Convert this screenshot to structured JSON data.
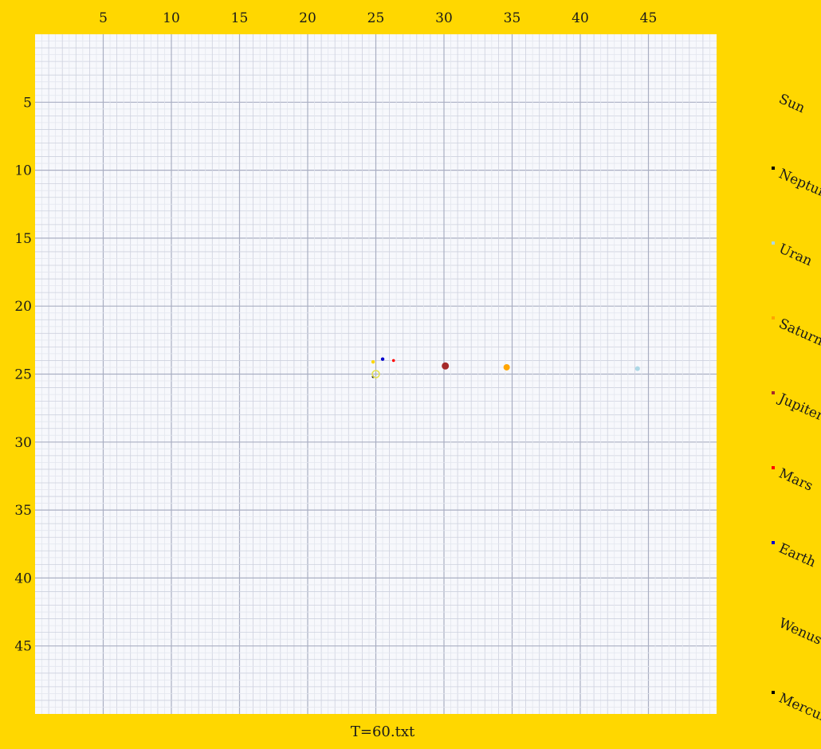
{
  "chart_data": {
    "type": "scatter",
    "title": "",
    "xlabel": "",
    "ylabel": "",
    "caption": "T=60.txt",
    "xlim": [
      0,
      50
    ],
    "ylim": [
      0,
      50
    ],
    "x_ticks": [
      5,
      10,
      15,
      20,
      25,
      30,
      35,
      40,
      45
    ],
    "y_ticks": [
      5,
      10,
      15,
      20,
      25,
      30,
      35,
      40,
      45
    ],
    "x_axis_position": "top",
    "y_axis_inverted": true,
    "grid": true,
    "legend_placement": "right",
    "series": [
      {
        "name": "Sun",
        "color": "#ffd700",
        "x": 25.0,
        "y": 25.0
      },
      {
        "name": "Neptun",
        "color": "#000000",
        "x": 24.8,
        "y": 25.2
      },
      {
        "name": "Uran",
        "color": "#add8e6",
        "x": 44.2,
        "y": 24.6
      },
      {
        "name": "Saturn",
        "color": "#ffa500",
        "x": 34.6,
        "y": 24.5
      },
      {
        "name": "Jupiter",
        "color": "#a52a2a",
        "x": 30.1,
        "y": 24.4
      },
      {
        "name": "Mars",
        "color": "#ff0000",
        "x": 26.3,
        "y": 24.0
      },
      {
        "name": "Earth",
        "color": "#0000cd",
        "x": 25.5,
        "y": 23.9
      },
      {
        "name": "Wenus",
        "color": "#ffd700",
        "x": 24.8,
        "y": 24.1
      },
      {
        "name": "Mercury",
        "color": "#000000",
        "x": 24.8,
        "y": 25.2
      }
    ]
  }
}
